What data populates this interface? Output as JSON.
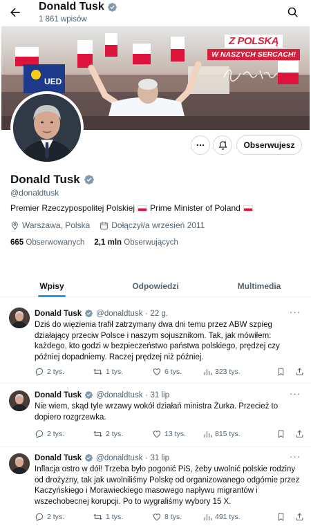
{
  "header": {
    "name": "Donald Tusk",
    "post_count": "1 861 wpisów"
  },
  "banner": {
    "badge_line1": "Z POLSKĄ",
    "badge_line2": "W NASZYCH SERCACH!"
  },
  "profile": {
    "name": "Donald Tusk",
    "handle": "@donaldtusk",
    "bio_part1": "Premier Rzeczypospolitej Polskiej",
    "bio_part2": "Prime Minister of Poland",
    "location": "Warszawa, Polska",
    "joined": "Dołączył/a wrzesień 2011",
    "following_count": "665",
    "following_label": "Obserwowanych",
    "followers_count": "2,1 mln",
    "followers_label": "Obserwujących",
    "follow_button": "Obserwujesz"
  },
  "tabs": [
    {
      "label": "Wpisy",
      "active": true
    },
    {
      "label": "Odpowiedzi",
      "active": false
    },
    {
      "label": "Multimedia",
      "active": false
    }
  ],
  "tweets": [
    {
      "name": "Donald Tusk",
      "handle": "@donaldtusk",
      "time": "· 22 g.",
      "lines": [
        "Dziś do więzienia trafił zatrzymany dwa dni temu przez ABW szpieg",
        "działający przeciw Polsce i naszym sojusznikom. Tak, jak mówiłem:",
        "każdego, kto godzi w bezpieczeństwo państwa polskiego, prędzej czy",
        "później dopadniemy. Raczej prędzej niż później."
      ],
      "replies": "2 tys.",
      "reposts": "1 tys.",
      "likes": "6 tys.",
      "views": "323 tys."
    },
    {
      "name": "Donald Tusk",
      "handle": "@donaldtusk",
      "time": "· 31 lip",
      "lines": [
        "Nie wiem, skąd tyle wrzawy wokół działań ministra Żurka. Przecież to",
        "dopiero rozgrzewka."
      ],
      "replies": "2 tys.",
      "reposts": "2 tys.",
      "likes": "13 tys.",
      "views": "815 tys."
    },
    {
      "name": "Donald Tusk",
      "handle": "@donaldtusk",
      "time": "· 31 lip",
      "lines": [
        "Inflacja ostro w dół! Trzeba było pogonić PiS, żeby uwolnić polskie rodziny",
        "od drożyzny, tak jak uwolniliśmy Polskę od organizowanego odgórnie przez",
        "Kaczyńskiego i Morawieckiego masowego napływu migrantów i",
        "wszechobecnej korupcji. Po to wygraliśmy wybory 15 X."
      ],
      "replies": "2 tys.",
      "reposts": "1 tys.",
      "likes": "8 tys.",
      "views": "491 tys."
    }
  ],
  "colors": {
    "accent": "#1d9bf0",
    "verified": "#829aab",
    "text": "#0f1419",
    "muted": "#536471",
    "flag_red": "#dc143c"
  }
}
